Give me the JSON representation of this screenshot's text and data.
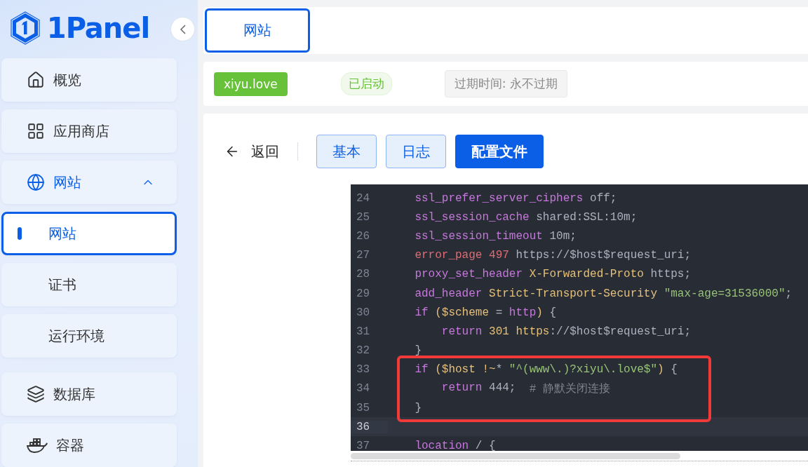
{
  "logo": {
    "text": "1Panel"
  },
  "menu": [
    {
      "label": "概览",
      "selected": false
    },
    {
      "label": "应用商店",
      "selected": false
    },
    {
      "label": "网站",
      "selected": false,
      "expanded": true,
      "children": [
        {
          "label": "网站",
          "selected": true
        },
        {
          "label": "证书",
          "selected": false
        },
        {
          "label": "运行环境",
          "selected": false
        }
      ]
    },
    {
      "label": "数据库",
      "selected": false
    },
    {
      "label": "容器",
      "selected": false
    }
  ],
  "tabs": [
    {
      "label": "网站",
      "selected": true
    }
  ],
  "site": {
    "domain": "xiyu.love",
    "status": "已启动",
    "expiry": "过期时间: 永不过期"
  },
  "toolbar": {
    "back": "返回",
    "buttons": [
      {
        "label": "基本",
        "selected": false
      },
      {
        "label": "日志",
        "selected": false
      },
      {
        "label": "配置文件",
        "selected": true
      }
    ]
  },
  "editor": {
    "lines_before": [
      {
        "number": "24",
        "current": false,
        "tokens": [
          {
            "kind": "keyword",
            "text": "    ssl_prefer_server_ciphers"
          },
          {
            "kind": "plain",
            "text": " off;"
          }
        ]
      },
      {
        "number": "25",
        "current": false,
        "tokens": [
          {
            "kind": "keyword",
            "text": "    ssl_session_cache"
          },
          {
            "kind": "plain",
            "text": " shared:SSL:10m;"
          }
        ]
      },
      {
        "number": "26",
        "current": false,
        "tokens": [
          {
            "kind": "keyword",
            "text": "    ssl_session_timeout"
          },
          {
            "kind": "plain",
            "text": " 10m;"
          }
        ]
      },
      {
        "number": "27",
        "current": false,
        "tokens": [
          {
            "kind": "error",
            "text": "    error_page 497"
          },
          {
            "kind": "plain",
            "text": " https://$host$request_uri;"
          }
        ]
      },
      {
        "number": "28",
        "current": false,
        "tokens": [
          {
            "kind": "keyword",
            "text": "    proxy_set_header"
          },
          {
            "kind": "attr",
            "text": " X-Forwarded-Proto"
          },
          {
            "kind": "plain",
            "text": " https;"
          }
        ]
      },
      {
        "number": "29",
        "current": false,
        "tokens": [
          {
            "kind": "keyword",
            "text": "    add_header"
          },
          {
            "kind": "attr",
            "text": " Strict-Transport-Security"
          },
          {
            "kind": "string",
            "text": " \"max-age=31536000\""
          },
          {
            "kind": "plain",
            "text": ";"
          }
        ]
      },
      {
        "number": "30",
        "current": false,
        "tokens": [
          {
            "kind": "keyword",
            "text": "    if"
          },
          {
            "kind": "attr",
            "text": " ($scheme"
          },
          {
            "kind": "plain",
            "text": " ="
          },
          {
            "kind": "keyword",
            "text": " http"
          },
          {
            "kind": "attr",
            "text": ")"
          },
          {
            "kind": "plain",
            "text": " {"
          }
        ]
      },
      {
        "number": "31",
        "current": false,
        "tokens": [
          {
            "kind": "keyword",
            "text": "        return"
          },
          {
            "kind": "attr",
            "text": " 301 https"
          },
          {
            "kind": "plain",
            "text": "://$host$request_uri;"
          }
        ]
      },
      {
        "number": "32",
        "current": false,
        "tokens": [
          {
            "kind": "plain",
            "text": "    }"
          }
        ]
      }
    ],
    "highlighted_lines": [
      {
        "number": "33",
        "current": false,
        "tokens": [
          {
            "kind": "keyword",
            "text": "    if"
          },
          {
            "kind": "attr",
            "text": " ($host !~"
          },
          {
            "kind": "plain",
            "text": "*"
          },
          {
            "kind": "string",
            "text": " \"^(www\\.)?xiyu\\.love$\""
          },
          {
            "kind": "attr",
            "text": ")"
          },
          {
            "kind": "plain",
            "text": " {"
          }
        ]
      },
      {
        "number": "34",
        "current": false,
        "tokens": [
          {
            "kind": "keyword",
            "text": "        return"
          },
          {
            "kind": "plain",
            "text": " 444;"
          },
          {
            "kind": "comment",
            "text": "  # 静默关闭连接"
          }
        ]
      },
      {
        "number": "35",
        "current": false,
        "tokens": [
          {
            "kind": "plain",
            "text": "    }"
          }
        ]
      }
    ],
    "lines_after": [
      {
        "number": "36",
        "current": true
      },
      {
        "number": "37",
        "current": false,
        "tokens": [
          {
            "kind": "keyword",
            "text": "    location"
          },
          {
            "kind": "plain",
            "text": " / {"
          }
        ]
      }
    ]
  }
}
